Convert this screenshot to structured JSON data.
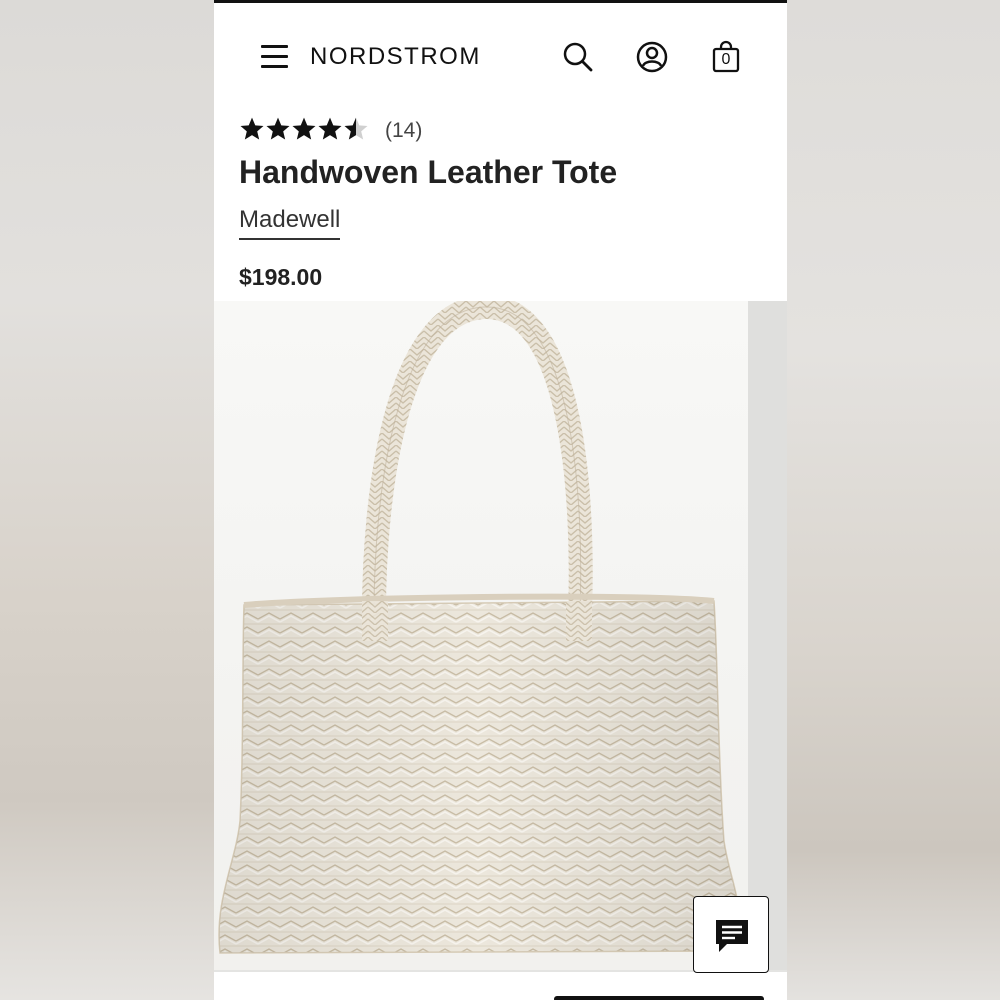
{
  "header": {
    "brand": "NORDSTROM",
    "bag_count": "0"
  },
  "product": {
    "rating": 4.5,
    "rating_max": 5,
    "review_count": "(14)",
    "title": "Handwoven Leather Tote",
    "brand": "Madewell",
    "price": "$198.00"
  },
  "icons": {
    "menu": "hamburger-menu-icon",
    "search": "search-icon",
    "account": "account-icon",
    "bag": "shopping-bag-icon",
    "chat": "chat-icon"
  },
  "colors": {
    "text": "#222222",
    "bag_leather": "#ece7dc",
    "bag_shadow": "#cfc6b4"
  }
}
